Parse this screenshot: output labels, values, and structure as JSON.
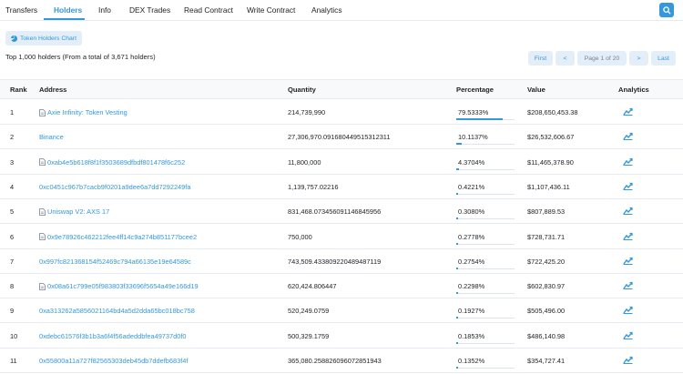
{
  "tabs": [
    {
      "label": "Transfers"
    },
    {
      "label": "Holders"
    },
    {
      "label": "Info"
    },
    {
      "label": "DEX Trades"
    },
    {
      "label": "Read Contract"
    },
    {
      "label": "Write Contract"
    },
    {
      "label": "Analytics"
    }
  ],
  "search_icon": "search-icon",
  "chart_button_label": "Token Holders Chart",
  "summary": "Top 1,000 holders (From a total of 3,671 holders)",
  "pager": {
    "first": "First",
    "prev": "<",
    "page": "Page 1 of 20",
    "next": ">",
    "last": "Last"
  },
  "columns": {
    "rank": "Rank",
    "address": "Address",
    "quantity": "Quantity",
    "percentage": "Percentage",
    "value": "Value",
    "analytics": "Analytics"
  },
  "colors": {
    "accent": "#3498db",
    "header_bg": "#f8f9fa",
    "border": "#e7eaf3"
  },
  "rows": [
    {
      "rank": "1",
      "address": "Axie Infinity: Token Vesting",
      "contract": true,
      "quantity": "214,739,990",
      "percentage": "79.5333%",
      "pct_value": 79.5333,
      "value": "$208,650,453.38"
    },
    {
      "rank": "2",
      "address": "Binance",
      "contract": false,
      "quantity": "27,306,970.091680449515312311",
      "percentage": "10.1137%",
      "pct_value": 10.1137,
      "value": "$26,532,606.67"
    },
    {
      "rank": "3",
      "address": "0xab4e5b618f8f1f3503689dfbdf801478f6c252",
      "contract": true,
      "quantity": "11,800,000",
      "percentage": "4.3704%",
      "pct_value": 4.3704,
      "value": "$11,465,378.90"
    },
    {
      "rank": "4",
      "address": "0xc0451c967b7cacb9f0201a9dee6a7dd7292249fa",
      "contract": false,
      "quantity": "1,139,757.02216",
      "percentage": "0.4221%",
      "pct_value": 0.4221,
      "value": "$1,107,436.11"
    },
    {
      "rank": "5",
      "address": "Uniswap V2: AXS 17",
      "contract": true,
      "quantity": "831,468.073456091146845956",
      "percentage": "0.3080%",
      "pct_value": 0.308,
      "value": "$807,889.53"
    },
    {
      "rank": "6",
      "address": "0x9e78926c462212fee4ff14c9a274b851177bcee2",
      "contract": true,
      "quantity": "750,000",
      "percentage": "0.2778%",
      "pct_value": 0.2778,
      "value": "$728,731.71"
    },
    {
      "rank": "7",
      "address": "0x997fc821368154f52469c794a66135e19e64589c",
      "contract": false,
      "quantity": "743,509.433809220489487119",
      "percentage": "0.2754%",
      "pct_value": 0.2754,
      "value": "$722,425.20"
    },
    {
      "rank": "8",
      "address": "0x08a61c799e05f983803f33696f5654a49e166d19",
      "contract": true,
      "quantity": "620,424.806447",
      "percentage": "0.2298%",
      "pct_value": 0.2298,
      "value": "$602,830.97"
    },
    {
      "rank": "9",
      "address": "0xa313262a5856021164bd4a5d2dda65bc018bc758",
      "contract": false,
      "quantity": "520,249.0759",
      "percentage": "0.1927%",
      "pct_value": 0.1927,
      "value": "$505,496.00"
    },
    {
      "rank": "10",
      "address": "0xdebc61576f3b1b3a6f4f56adeddbfea49737d0f0",
      "contract": false,
      "quantity": "500,329.1759",
      "percentage": "0.1853%",
      "pct_value": 0.1853,
      "value": "$486,140.98"
    },
    {
      "rank": "11",
      "address": "0x55800a11a727f82565303deb45db7ddefb683f4f",
      "contract": false,
      "quantity": "365,080.258826096072851943",
      "percentage": "0.1352%",
      "pct_value": 0.1352,
      "value": "$354,727.41"
    }
  ]
}
